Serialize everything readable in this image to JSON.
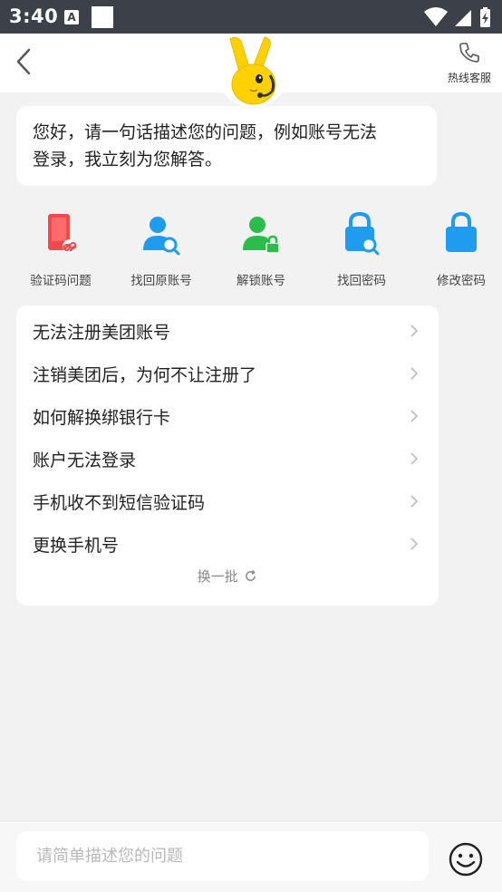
{
  "status_bar": {
    "time": "3:40",
    "notification_glyph": "A"
  },
  "header": {
    "hotline_label": "热线客服"
  },
  "greeting": {
    "line1": "您好，请一句话描述您的问题，例如账号无法",
    "line2": "登录，我立刻为您解答。"
  },
  "shortcuts": [
    {
      "label": "验证码问题",
      "icon": "phone-unlink-icon",
      "color": "#f24a4a"
    },
    {
      "label": "找回原账号",
      "icon": "user-search-icon",
      "color": "#1f9bf0"
    },
    {
      "label": "解锁账号",
      "icon": "user-lock-icon",
      "color": "#2bbd4a"
    },
    {
      "label": "找回密码",
      "icon": "lock-search-icon",
      "color": "#1f9bf0"
    },
    {
      "label": "修改密码",
      "icon": "lock-icon",
      "color": "#1f9bf0"
    }
  ],
  "faq": {
    "items": [
      "无法注册美团账号",
      "注销美团后，为何不让注册了",
      "如何解换绑银行卡",
      "账户无法登录",
      "手机收不到短信验证码",
      "更换手机号"
    ],
    "refresh_label": "换一批"
  },
  "input": {
    "placeholder": "请简单描述您的问题"
  },
  "colors": {
    "status_bar_bg": "#3b4049",
    "brand_yellow": "#ffd100",
    "blue_icon": "#1f9bf0",
    "green_icon": "#2bbd4a",
    "red_icon": "#f24a4a"
  }
}
